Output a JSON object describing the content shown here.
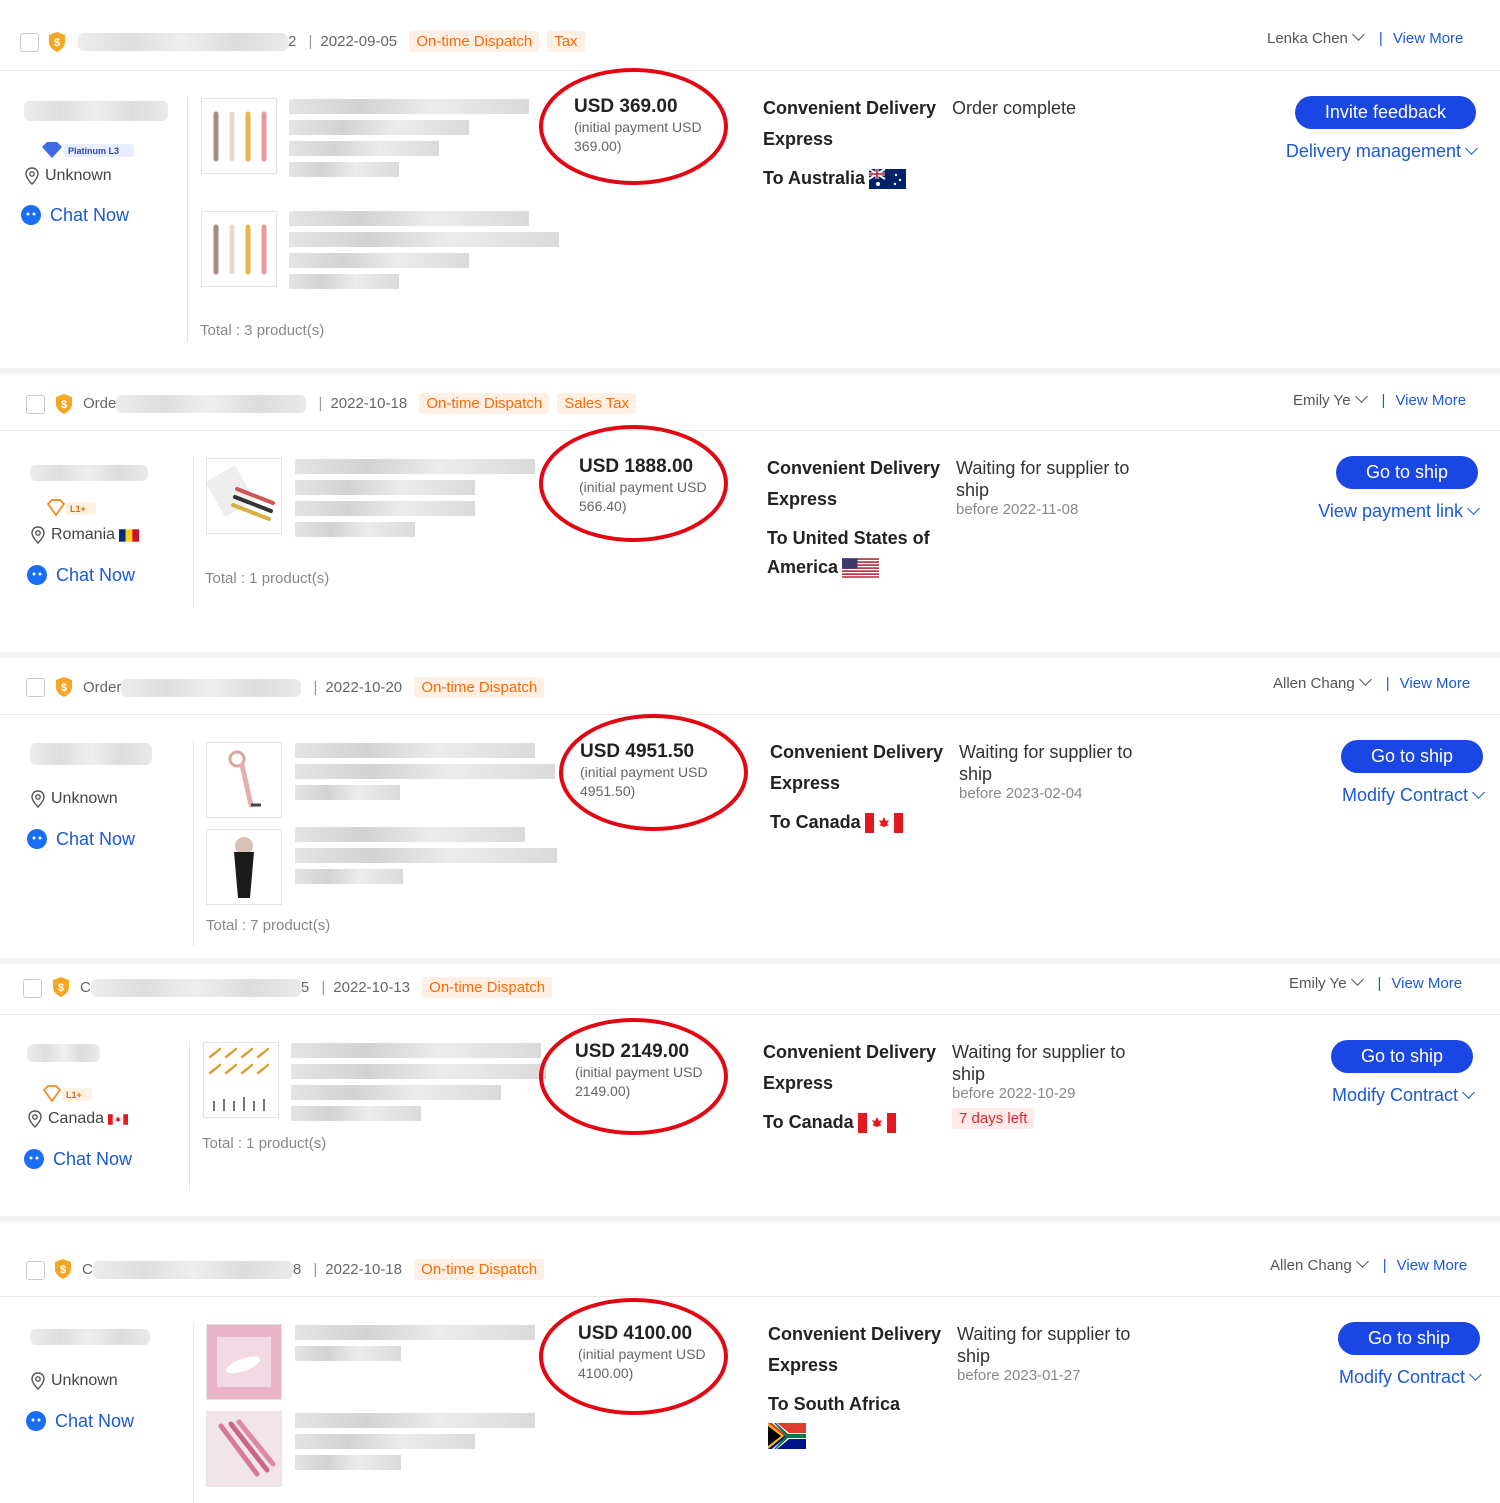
{
  "labels": {
    "on_time": "On-time Dispatch",
    "view_more": "View More",
    "chat_now": "Chat Now",
    "convenient_delivery": "Convenient Delivery",
    "express": "Express",
    "initial_prefix": "(initial payment USD",
    "separator": "|",
    "vbar": "|"
  },
  "colors": {
    "accent": "#1a46e3",
    "link": "#1a59d8",
    "tag_orange": "#ff6a00",
    "highlight_ring": "#e30613",
    "warn_red": "#e3262c"
  },
  "orders": [
    {
      "order_no_prefix": "",
      "order_no_suffix": "2",
      "date": "2022-09-05",
      "tags": [
        "On-time Dispatch",
        "Tax"
      ],
      "assignee": "Lenka Chen",
      "buyer_badge": "Platinum L3",
      "buyer_location": "Unknown",
      "price": "USD 369.00",
      "initial_payment": "(initial payment USD 369.00)",
      "ship_line1": "Convenient Delivery",
      "ship_line2": "Express",
      "destination": "To Australia",
      "flag": "australia",
      "status": "Order complete",
      "status_date": "",
      "warning": "",
      "primary_button": "Invite feedback",
      "secondary_link": "Delivery management",
      "total": "Total : 3 product(s)"
    },
    {
      "order_no_prefix": "Orde",
      "order_no_suffix": "",
      "date": "2022-10-18",
      "tags": [
        "On-time Dispatch",
        "Sales Tax"
      ],
      "assignee": "Emily Ye",
      "buyer_badge": "L1+",
      "buyer_location": "Romania",
      "price": "USD 1888.00",
      "initial_payment": "(initial payment USD 566.40)",
      "ship_line1": "Convenient Delivery",
      "ship_line2": "Express",
      "destination": "To United States of America",
      "flag": "usa",
      "status": "Waiting for supplier to ship",
      "status_date": "before 2022-11-08",
      "warning": "",
      "primary_button": "Go to ship",
      "secondary_link": "View payment link",
      "total": "Total : 1 product(s)"
    },
    {
      "order_no_prefix": "Order",
      "order_no_suffix": "",
      "date": "2022-10-20",
      "tags": [
        "On-time Dispatch"
      ],
      "assignee": "Allen Chang",
      "buyer_badge": "",
      "buyer_location": "Unknown",
      "price": "USD 4951.50",
      "initial_payment": "(initial payment USD 4951.50)",
      "ship_line1": "Convenient Delivery",
      "ship_line2": "Express",
      "destination": "To Canada",
      "flag": "canada",
      "status": "Waiting for supplier to ship",
      "status_date": "before 2023-02-04",
      "warning": "",
      "primary_button": "Go to ship",
      "secondary_link": "Modify Contract",
      "total": "Total : 7 product(s)"
    },
    {
      "order_no_prefix": "C",
      "order_no_suffix": "5",
      "date": "2022-10-13",
      "tags": [
        "On-time Dispatch"
      ],
      "assignee": "Emily Ye",
      "buyer_badge": "L1+",
      "buyer_location": "Canada",
      "price": "USD 2149.00",
      "initial_payment": "(initial payment USD 2149.00)",
      "ship_line1": "Convenient Delivery",
      "ship_line2": "Express",
      "destination": "To Canada",
      "flag": "canada",
      "status": "Waiting for supplier to ship",
      "status_date": "before 2022-10-29",
      "warning": "7 days left",
      "primary_button": "Go to ship",
      "secondary_link": "Modify Contract",
      "total": "Total : 1 product(s)"
    },
    {
      "order_no_prefix": "C",
      "order_no_suffix": "8",
      "date": "2022-10-18",
      "tags": [
        "On-time Dispatch"
      ],
      "assignee": "Allen Chang",
      "buyer_badge": "",
      "buyer_location": "Unknown",
      "price": "USD 4100.00",
      "initial_payment": "(initial payment USD 4100.00)",
      "ship_line1": "Convenient Delivery",
      "ship_line2": "Express",
      "destination": "To South Africa",
      "flag": "southafrica",
      "status": "Waiting for supplier to ship",
      "status_date": "before 2023-01-27",
      "warning": "",
      "primary_button": "Go to ship",
      "secondary_link": "Modify Contract",
      "total": ""
    }
  ]
}
